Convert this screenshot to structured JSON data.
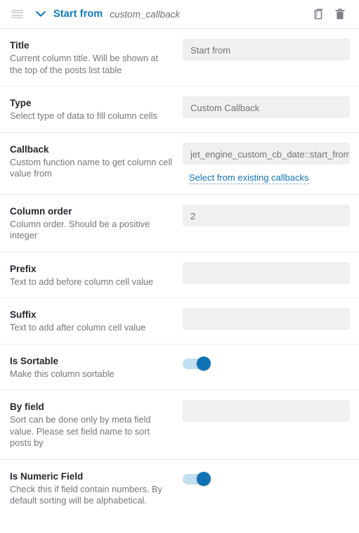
{
  "header": {
    "drag_handle_icon": "drag-handle-icon",
    "collapse_icon": "chevron-down-icon",
    "title": "Start from",
    "subtitle": "custom_callback",
    "duplicate_icon": "duplicate-icon",
    "delete_icon": "trash-icon",
    "accent_color": "#0b7ac0"
  },
  "rows": [
    {
      "title": "Title",
      "desc": "Current column title. Will be shown at the top of the posts list table",
      "control": "text",
      "value": "Start from",
      "placeholder": ""
    },
    {
      "title": "Type",
      "desc": "Select type of data to fill column cells",
      "control": "text",
      "value": "Custom Callback",
      "placeholder": ""
    },
    {
      "title": "Callback",
      "desc": "Custom function name to get column cell value from",
      "control": "text-with-link",
      "value": "jet_engine_custom_cb_date::start_from::F j,",
      "placeholder": "",
      "link_label": "Select from existing callbacks"
    },
    {
      "title": "Column order",
      "desc": "Column order. Should be a positive integer",
      "control": "text",
      "value": "2",
      "placeholder": ""
    },
    {
      "title": "Prefix",
      "desc": "Text to add before column cell value",
      "control": "text",
      "value": "",
      "placeholder": ""
    },
    {
      "title": "Suffix",
      "desc": "Text to add after column cell value",
      "control": "text",
      "value": "",
      "placeholder": ""
    },
    {
      "title": "Is Sortable",
      "desc": "Make this column sortable",
      "control": "toggle",
      "value": "on"
    },
    {
      "title": "By field",
      "desc": "Sort can be done only by meta field value. Please set field name to sort posts by",
      "control": "text",
      "value": "",
      "placeholder": ""
    },
    {
      "title": "Is Numeric Field",
      "desc": "Check this if field contain numbers. By default sorting will be alphabetical.",
      "control": "toggle",
      "value": "on"
    }
  ],
  "colors": {
    "accent": "#0b7ac0",
    "toggle_on_knob": "#0f72b5",
    "toggle_on_track": "#c2dff0",
    "input_bg": "#f0f0f1",
    "separator": "#eceef0"
  }
}
